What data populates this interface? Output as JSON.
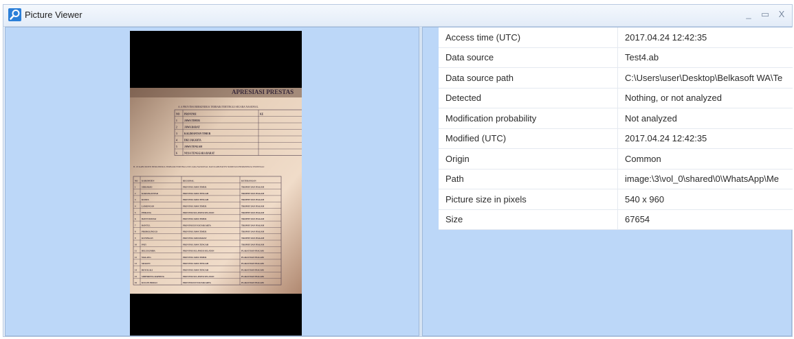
{
  "window": {
    "title": "Picture Viewer"
  },
  "controls": {
    "minimize": "_",
    "maximize": "▭",
    "close": "X"
  },
  "properties": [
    {
      "key": "Access time (UTC)",
      "value": "2017.04.24 12:42:35"
    },
    {
      "key": "Data source",
      "value": "Test4.ab"
    },
    {
      "key": "Data source path",
      "value": "C:\\Users\\user\\Desktop\\Belkasoft WA\\Te"
    },
    {
      "key": "Detected",
      "value": "Nothing, or not analyzed"
    },
    {
      "key": "Modification probability",
      "value": "Not analyzed"
    },
    {
      "key": "Modified (UTC)",
      "value": "2017.04.24 12:42:35"
    },
    {
      "key": "Origin",
      "value": "Common"
    },
    {
      "key": "Path",
      "value": "image:\\3\\vol_0\\shared\\0\\WhatsApp\\Me"
    },
    {
      "key": "Picture size in pixels",
      "value": "540 x 960"
    },
    {
      "key": "Size",
      "value": "67654"
    }
  ],
  "photo_text": {
    "header": "APRESIASI PRESTAS",
    "section_a": "A. 6 PROVINSI BERKINERJA TERBAIK/TERTINGGI SECARA NASIONAL",
    "table_a_headers": [
      "NO",
      "PROVINSI",
      "KE"
    ],
    "table_a_rows": [
      [
        "1",
        "JAWA TIMUR"
      ],
      [
        "2",
        "JAWA BARAT"
      ],
      [
        "3",
        "KALIMANTAN TIMUR"
      ],
      [
        "4",
        "DKI JAKARTA"
      ],
      [
        "5",
        "JAWA TENGAH"
      ],
      [
        "6",
        "NUSA TENGGARA BARAT"
      ]
    ],
    "section_b": "B. 18 KABUPATEN BERKINERJA TERBAIK/TERTINGGI SECARA NASIONAL DAN KABUPATEN NOMINASI BERKINERJA TERTINGGI",
    "table_b_headers": [
      "NO",
      "KABUPATEN",
      "REGIONAL",
      "KETERANGAN"
    ],
    "table_b_rows": [
      [
        "1",
        "SIDOARJO",
        "PROVINSI JAWA TIMUR",
        "TROPHY DAN PIAGAM"
      ],
      [
        "2",
        "KARANGANYAR",
        "PROVINSI JAWA TENGAH",
        "TROPHY DAN PIAGAM"
      ],
      [
        "3",
        "KUDUS",
        "PROVINSI JAWA TENGAH",
        "TROPHY DAN PIAGAM"
      ],
      [
        "4",
        "LAMONGAN",
        "PROVINSI JAWA TIMUR",
        "TROPHY DAN PIAGAM"
      ],
      [
        "5",
        "PINRANG",
        "PROVINSI SULAWESI SELATAN",
        "TROPHY DAN PIAGAM"
      ],
      [
        "6",
        "BANYUWANGI",
        "PROVINSI JAWA TIMUR",
        "TROPHY DAN PIAGAM"
      ],
      [
        "7",
        "BANTUL",
        "PROVINSI DI YOGYAKARTA",
        "TROPHY DAN PIAGAM"
      ],
      [
        "8",
        "PROBOLINGGO",
        "PROVINSI JAWA TIMUR",
        "TROPHY DAN PIAGAM"
      ],
      [
        "9",
        "KUNINGAN",
        "PROVINSI JAWA BARAT",
        "TROPHY DAN PIAGAM"
      ],
      [
        "10",
        "PATI",
        "PROVINSI JAWA TENGAH",
        "TROPHY DAN PIAGAM"
      ],
      [
        "11",
        "BULUKUMBA",
        "PROVINSI SULAWESI SELATAN",
        "PLAKAT DAN PIAGAM"
      ],
      [
        "12",
        "MALANG",
        "PROVINSI JAWA TIMUR",
        "PLAKAT DAN PIAGAM"
      ],
      [
        "13",
        "SRAGEN",
        "PROVINSI JAWA TENGAH",
        "PLAKAT DAN PIAGAM"
      ],
      [
        "14",
        "BOYOLALI",
        "PROVINSI JAWA TENGAH",
        "PLAKAT DAN PIAGAM"
      ],
      [
        "15",
        "SIDENRENG RAPPANG",
        "PROVINSI SULAWESI SELATAN",
        "PLAKAT DAN PIAGAM"
      ],
      [
        "16",
        "KULON PROGO",
        "PROVINSI DI YOGYAKARTA",
        "PLAKAT DAN PIAGAM"
      ]
    ]
  }
}
